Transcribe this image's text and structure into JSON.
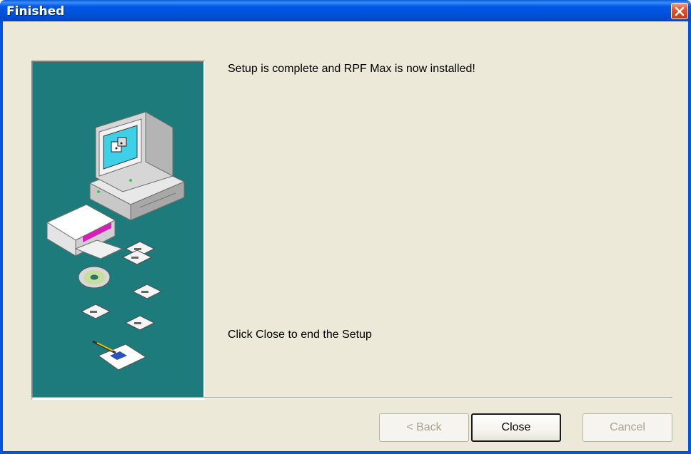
{
  "window": {
    "title": "Finished",
    "close_icon": "close-icon"
  },
  "colors": {
    "titlebar": "#0058e6",
    "client": "#ece9d8",
    "art_background": "#1e7b7b",
    "close_button": "#e2552f"
  },
  "content": {
    "message_complete": "Setup is complete and RPF Max is now installed!",
    "message_instruction": "Click Close to end the Setup"
  },
  "buttons": {
    "back": "< Back",
    "close": "Close",
    "cancel": "Cancel"
  }
}
